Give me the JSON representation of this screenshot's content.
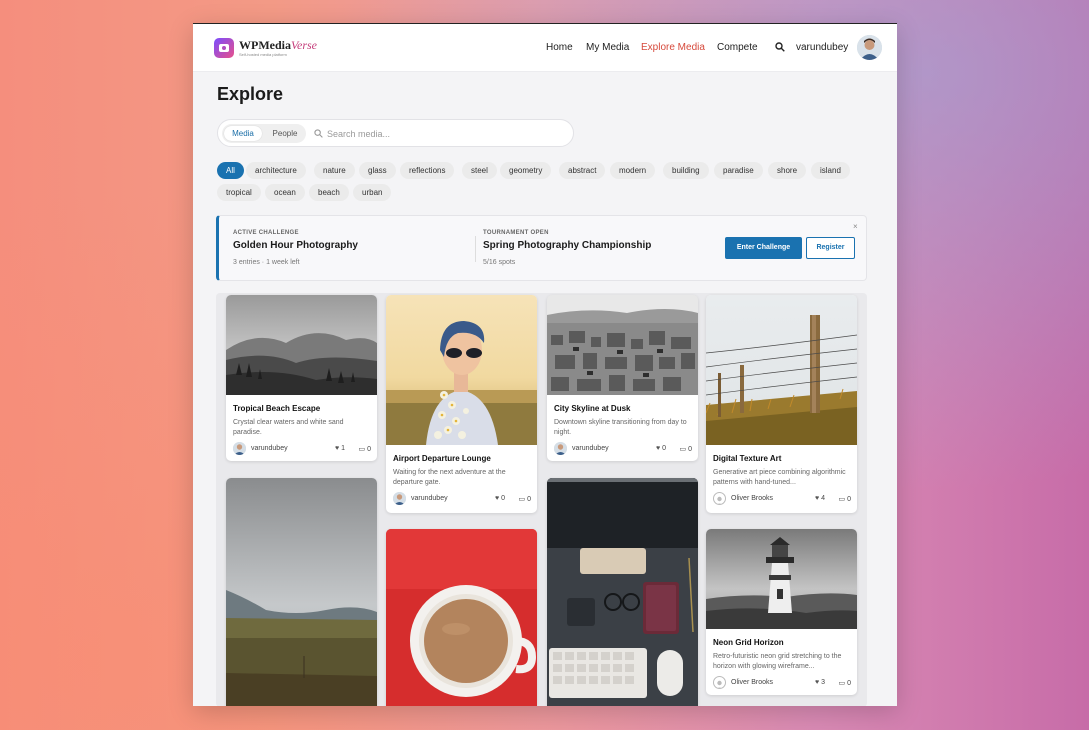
{
  "header": {
    "brand_main": "WPMedia",
    "brand_accent": "Verse",
    "tagline": "Self-hosted media platform",
    "nav": [
      "Home",
      "My Media",
      "Explore Media",
      "Compete"
    ],
    "username": "varundubey"
  },
  "page": {
    "title": "Explore"
  },
  "search": {
    "tab_media": "Media",
    "tab_people": "People",
    "placeholder": "Search media..."
  },
  "tags": [
    "All",
    "architecture",
    "nature",
    "glass",
    "reflections",
    "steel",
    "geometry",
    "abstract",
    "modern",
    "building",
    "paradise",
    "shore",
    "island",
    "tropical",
    "ocean",
    "beach",
    "urban"
  ],
  "banner": {
    "challenge_kicker": "ACTIVE CHALLENGE",
    "challenge_title": "Golden Hour Photography",
    "challenge_meta": "3 entries · 1 week left",
    "tournament_kicker": "TOURNAMENT OPEN",
    "tournament_title": "Spring Photography Championship",
    "tournament_meta": "5/16 spots",
    "enter_label": "Enter Challenge",
    "register_label": "Register",
    "close_glyph": "×"
  },
  "cards": [
    {
      "title": "Tropical Beach Escape",
      "desc": "Crystal clear waters and white sand paradise.",
      "user": "varundubey",
      "likes": "1",
      "comments": "0"
    },
    {
      "title": "Airport Departure Lounge",
      "desc": "Waiting for the next adventure at the departure gate.",
      "user": "varundubey",
      "likes": "0",
      "comments": "0"
    },
    {
      "title": "City Skyline at Dusk",
      "desc": "Downtown skyline transitioning from day to night.",
      "user": "varundubey",
      "likes": "0",
      "comments": "0"
    },
    {
      "title": "Digital Texture Art",
      "desc": "Generative art piece combining algorithmic patterns with hand-tuned...",
      "user": "Oliver Brooks",
      "likes": "4",
      "comments": "0"
    },
    {
      "title": "Neon Grid Horizon",
      "desc": "Retro-futuristic neon grid stretching to the horizon with glowing wireframe...",
      "user": "Oliver Brooks",
      "likes": "3",
      "comments": "0"
    }
  ],
  "colors": {
    "accent": "#1a72b0",
    "nav_active": "#d6493b"
  }
}
